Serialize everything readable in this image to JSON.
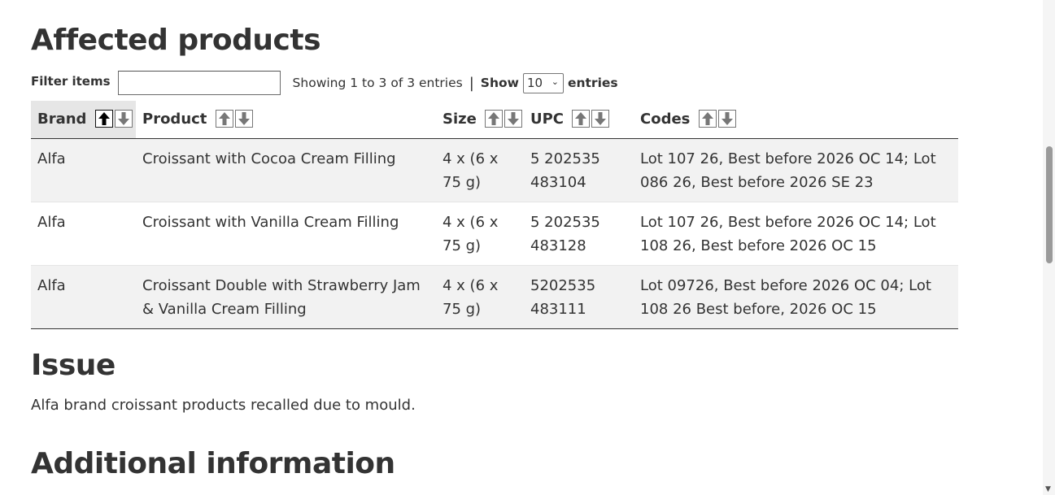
{
  "headings": {
    "affected": "Affected products",
    "issue": "Issue",
    "additional": "Additional information"
  },
  "controls": {
    "filter_label": "Filter items",
    "filter_value": "",
    "info": "Showing 1 to 3 of 3 entries",
    "separator": "|",
    "show_label": "Show",
    "show_value": "10",
    "entries_label": "entries"
  },
  "table": {
    "columns": [
      "Brand",
      "Product",
      "Size",
      "UPC",
      "Codes"
    ],
    "sorted_column": "Brand",
    "rows": [
      {
        "brand": "Alfa",
        "product": "Croissant with Cocoa Cream Filling",
        "size": "4 x (6 x 75 g)",
        "upc": "5 202535 483104",
        "codes": "Lot 107 26, Best before 2026 OC 14; Lot 086 26, Best before 2026 SE 23"
      },
      {
        "brand": "Alfa",
        "product": "Croissant with Vanilla Cream Filling",
        "size": "4 x (6 x 75 g)",
        "upc": "5 202535 483128",
        "codes": "Lot 107 26, Best before 2026 OC 14; Lot 108 26, Best before 2026 OC 15"
      },
      {
        "brand": "Alfa",
        "product": "Croissant Double with Strawberry Jam & Vanilla Cream Filling",
        "size": "4 x (6 x 75 g)",
        "upc": "5202535 483111",
        "codes": "Lot 09726, Best before 2026 OC 04; Lot 108 26 Best before, 2026 OC 15"
      }
    ]
  },
  "issue_text": "Alfa brand croissant products recalled due to mould.",
  "icons": {
    "sort_up": "arrow-up-icon",
    "sort_down": "arrow-down-icon",
    "select_chevron": "chevron-down-icon"
  }
}
